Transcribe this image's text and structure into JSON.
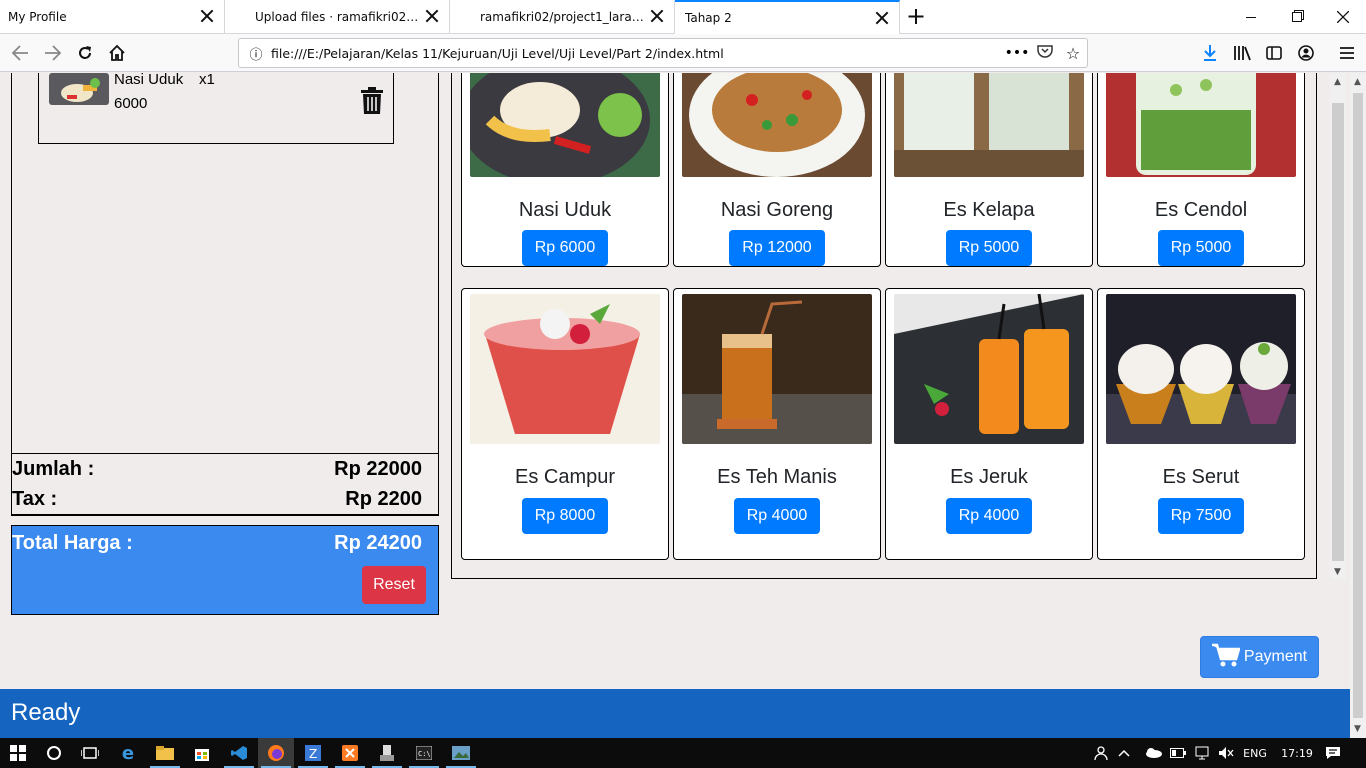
{
  "browser": {
    "tabs": [
      {
        "title": "My Profile"
      },
      {
        "title": "Upload files · ramafikri02/proje"
      },
      {
        "title": "ramafikri02/project1_laravel"
      },
      {
        "title": "Tahap 2"
      }
    ],
    "url": "file:///E:/Pelajaran/Kelas 11/Kejuruan/Uji Level/Uji Level/Part 2/index.html"
  },
  "order": {
    "items": [
      {
        "name": "Nasi Uduk",
        "qty": "x1",
        "price": "6000"
      }
    ]
  },
  "summary": {
    "jumlah_label": "Jumlah :",
    "jumlah_value": "Rp 22000",
    "tax_label": "Tax :",
    "tax_value": "Rp 2200",
    "total_label": "Total Harga :",
    "total_value": "Rp 24200",
    "reset_label": "Reset"
  },
  "menu": [
    {
      "name": "Nasi Uduk",
      "price": "Rp 6000"
    },
    {
      "name": "Nasi Goreng",
      "price": "Rp 12000"
    },
    {
      "name": "Es Kelapa",
      "price": "Rp 5000"
    },
    {
      "name": "Es Cendol",
      "price": "Rp 5000"
    },
    {
      "name": "Es Campur",
      "price": "Rp 8000"
    },
    {
      "name": "Es Teh Manis",
      "price": "Rp 4000"
    },
    {
      "name": "Es Jeruk",
      "price": "Rp 4000"
    },
    {
      "name": "Es Serut",
      "price": "Rp 7500"
    }
  ],
  "payment_label": "Payment",
  "status_text": "Ready",
  "taskbar": {
    "lang": "ENG",
    "time": "17:19"
  },
  "colors": {
    "accent": "#007bff",
    "total_bg": "#3b8af0",
    "reset": "#dc3545",
    "status_bar": "#1565c0"
  }
}
